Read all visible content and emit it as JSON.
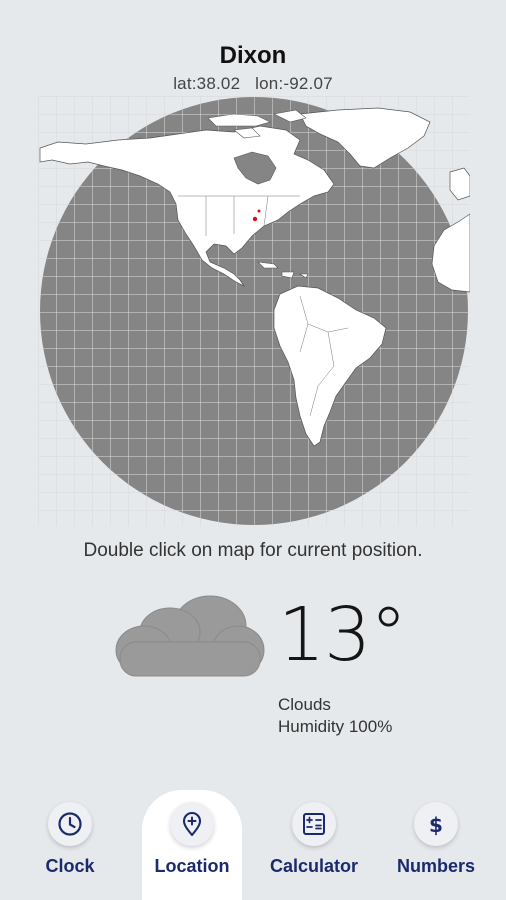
{
  "location": {
    "city": "Dixon",
    "lat_label": "lat:38.02",
    "lon_label": "lon:-92.07"
  },
  "map": {
    "hint": "Double click on map for current position.",
    "marker_color": "#e01010",
    "globe_color": "#858585",
    "land_color": "#ffffff"
  },
  "weather": {
    "icon": "cloud-icon",
    "temperature": "13°",
    "condition": "Clouds",
    "humidity": "Humidity 100%"
  },
  "nav": {
    "accent": "#1a2a6c",
    "items": [
      {
        "label": "Clock",
        "icon": "clock-icon",
        "active": false
      },
      {
        "label": "Location",
        "icon": "location-pin-icon",
        "active": true
      },
      {
        "label": "Calculator",
        "icon": "calculator-icon",
        "active": false
      },
      {
        "label": "Numbers",
        "icon": "dollar-icon",
        "active": false
      }
    ]
  }
}
